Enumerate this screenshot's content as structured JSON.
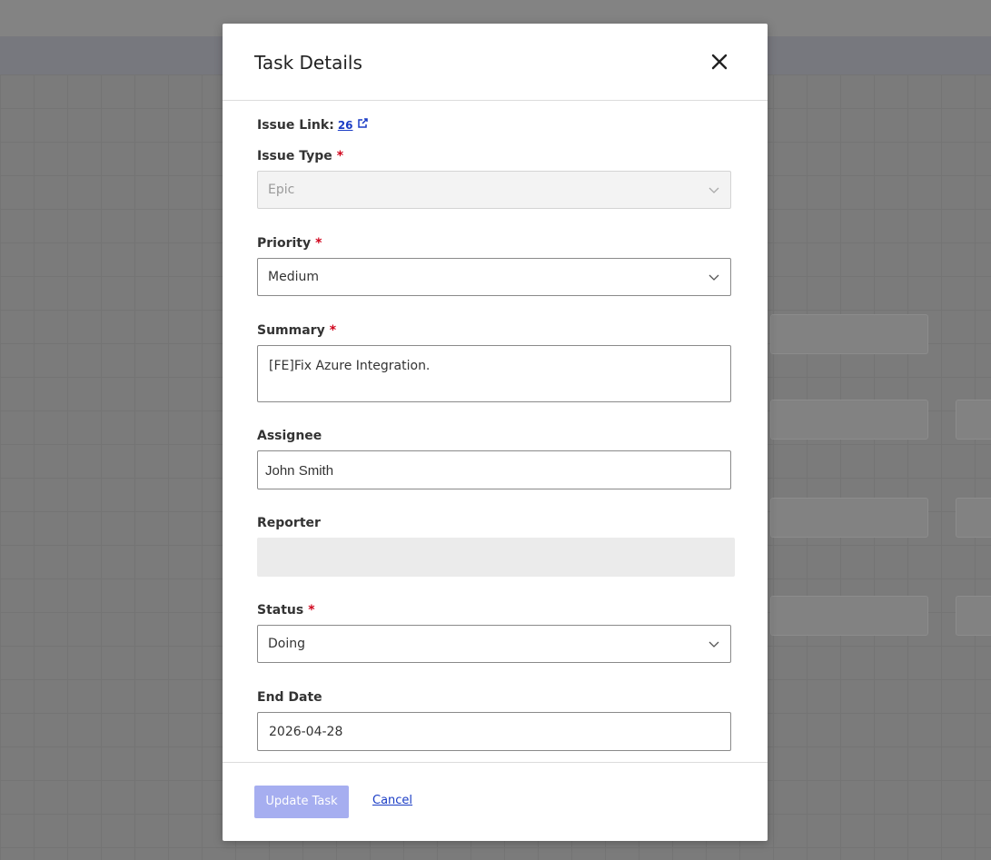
{
  "modal": {
    "title": "Task Details",
    "issue_link_label": "Issue Link:",
    "issue_link_value": "26",
    "fields": {
      "issue_type": {
        "label": "Issue Type",
        "value": "Epic"
      },
      "priority": {
        "label": "Priority",
        "value": "Medium"
      },
      "summary": {
        "label": "Summary",
        "value": "[FE]Fix Azure Integration."
      },
      "assignee": {
        "label": "Assignee",
        "value": "John Smith"
      },
      "reporter": {
        "label": "Reporter",
        "value": ""
      },
      "status": {
        "label": "Status",
        "value": "Doing"
      },
      "end_date": {
        "label": "End Date",
        "value": "2026-04-28"
      }
    },
    "required_marker": "*",
    "update_button": "Update Task",
    "cancel_link": "Cancel"
  },
  "colors": {
    "required": "#d0021b",
    "link": "#1a3cc5",
    "primary_disabled": "#a6aef0"
  }
}
